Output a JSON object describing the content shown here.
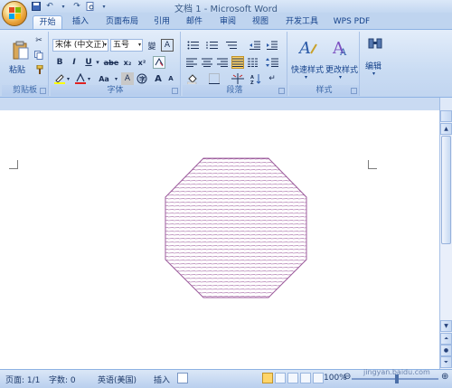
{
  "window": {
    "title": "文档 1 - Microsoft Word"
  },
  "quick_access": {
    "items": [
      "save-icon",
      "undo-icon",
      "redo-icon",
      "print-preview-icon",
      "customize-icon"
    ]
  },
  "tabs": [
    {
      "label": "开始",
      "active": true
    },
    {
      "label": "插入"
    },
    {
      "label": "页面布局"
    },
    {
      "label": "引用"
    },
    {
      "label": "邮件"
    },
    {
      "label": "审阅"
    },
    {
      "label": "视图"
    },
    {
      "label": "开发工具"
    },
    {
      "label": "WPS PDF"
    }
  ],
  "ribbon": {
    "clipboard": {
      "label": "剪贴板",
      "paste_label": "粘贴"
    },
    "font": {
      "label": "字体",
      "font_name": "宋体 (中文正)",
      "font_size": "五号",
      "wen_icon_text": "變",
      "border_char_text": "A",
      "bold": "B",
      "italic": "I",
      "underline": "U",
      "strike": "abe",
      "subscript": "x₂",
      "superscript": "x²",
      "clear": "A",
      "grow": "A",
      "shrink": "A",
      "case": "Aa"
    },
    "paragraph": {
      "label": "段落"
    },
    "styles": {
      "label": "样式",
      "quick_style_label": "快速样式",
      "change_style_label": "更改样式"
    },
    "editing": {
      "label": "编辑"
    }
  },
  "document": {
    "shape": {
      "type": "octagon",
      "fill": "horizontal-hatch",
      "color": "#9c5b9c"
    }
  },
  "statusbar": {
    "page": "页面: 1/1",
    "words": "字数: 0",
    "language": "英语(美国)",
    "insert_mode": "插入",
    "zoom": "100%",
    "watermark": "jingyan.baidu.com"
  },
  "colors": {
    "accent": "#15428b",
    "ribbon_bg": "#cadcf3",
    "shape_stroke": "#9c5b9c"
  }
}
